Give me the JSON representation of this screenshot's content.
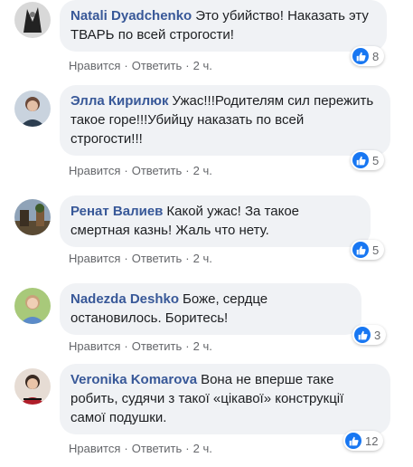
{
  "colors": {
    "author": "#385898",
    "bubble": "#f0f2f5",
    "like": "#1877f2",
    "meta": "#65676b"
  },
  "comments": [
    {
      "author": "Natali Dyadchenko",
      "text": "Это убийство! Наказать эту ТВАРЬ по всей строгости!",
      "reactions": "8",
      "like": "Нравится",
      "reply": "Ответить",
      "time": "2 ч.",
      "reaction_icon": "like-icon"
    },
    {
      "author": "Элла Кирилюк",
      "text": "Ужас!!!Родителям сил пережить такое горе!!!Убийцу наказать по всей строгости!!!",
      "reactions": "5",
      "like": "Нравится",
      "reply": "Ответить",
      "time": "2 ч.",
      "reaction_icon": "like-icon"
    },
    {
      "author": "Ренат Валиев",
      "text": "Какой ужас! За такое смертная казнь! Жаль что нету.",
      "reactions": "5",
      "like": "Нравится",
      "reply": "Ответить",
      "time": "2 ч.",
      "reaction_icon": "like-icon"
    },
    {
      "author": "Nadezda Deshko",
      "text": "Боже, сердце остановилось. Боритесь!",
      "reactions": "3",
      "like": "Нравится",
      "reply": "Ответить",
      "time": "2 ч.",
      "reaction_icon": "like-icon"
    },
    {
      "author": "Veronika Komarova",
      "text": "Вона не вперше таке робить, судячи з такої «цікавої» конструкції самої подушки.",
      "reactions": "12",
      "like": "Нравится",
      "reply": "Ответить",
      "time": "2 ч.",
      "reaction_icon": "like-icon"
    }
  ]
}
